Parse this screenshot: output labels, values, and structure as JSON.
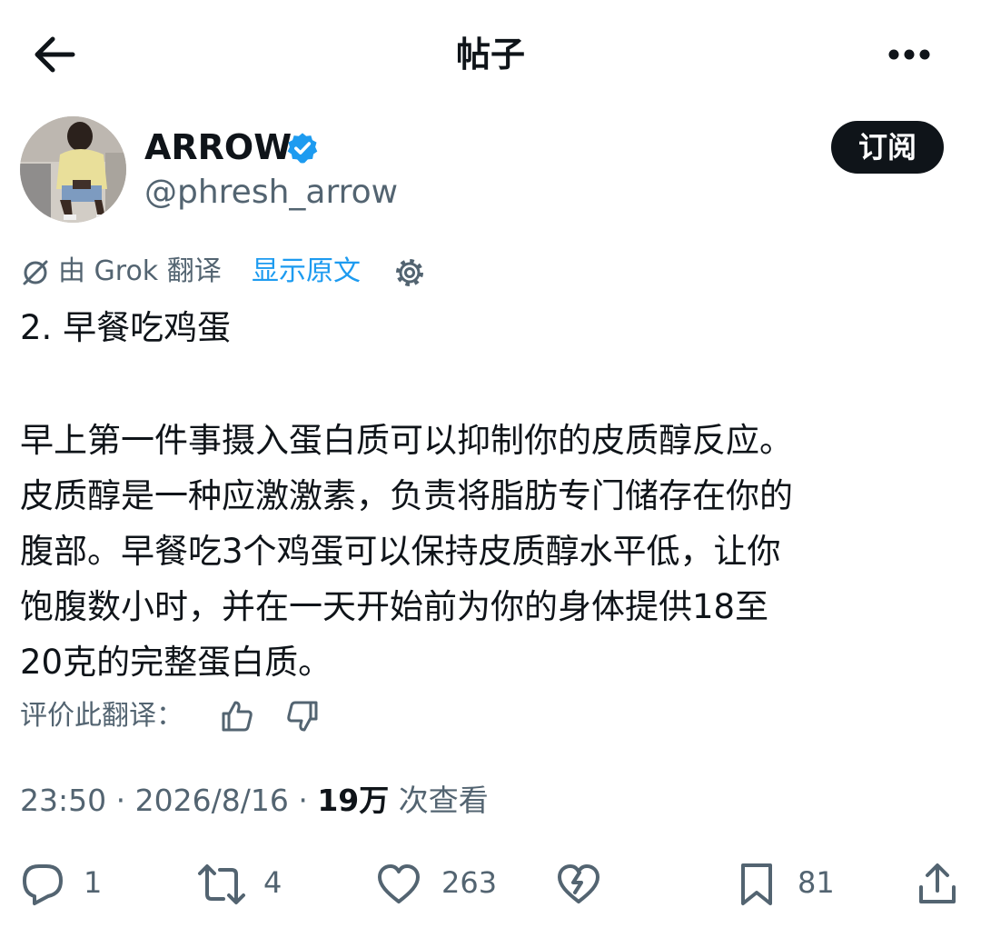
{
  "header": {
    "title": "帖子",
    "back_icon": "arrow-left-icon",
    "more_icon": "more-horizontal-icon"
  },
  "author": {
    "display_name": "ARROW",
    "handle": "@phresh_arrow",
    "verified_icon": "verified-badge-icon",
    "subscribe_label": "订阅"
  },
  "translation": {
    "label": "由 Grok 翻译",
    "show_original": "显示原文",
    "settings_icon": "gear-icon"
  },
  "post": {
    "heading": "2. 早餐吃鸡蛋",
    "lines": [
      "早上第一件事摄入蛋白质可以抑制你的皮质醇反应。",
      "皮质醇是一种应激激素，负责将脂肪专门储存在你的",
      "腹部。早餐吃3个鸡蛋可以保持皮质醇水平低，让你",
      "饱腹数小时，并在一天开始前为你的身体提供18至",
      "20克的完整蛋白质。"
    ]
  },
  "rate": {
    "label": "评价此翻译："
  },
  "meta": {
    "time": "23:50",
    "separator": "·",
    "date": "2026/8/16",
    "views_count": "19万",
    "views_label": "次查看"
  },
  "actions": {
    "replies": "1",
    "reposts": "4",
    "likes": "263",
    "bookmarks": "81"
  },
  "colors": {
    "accent": "#1d9bf0",
    "text": "#0f1419",
    "secondary": "#536471"
  }
}
